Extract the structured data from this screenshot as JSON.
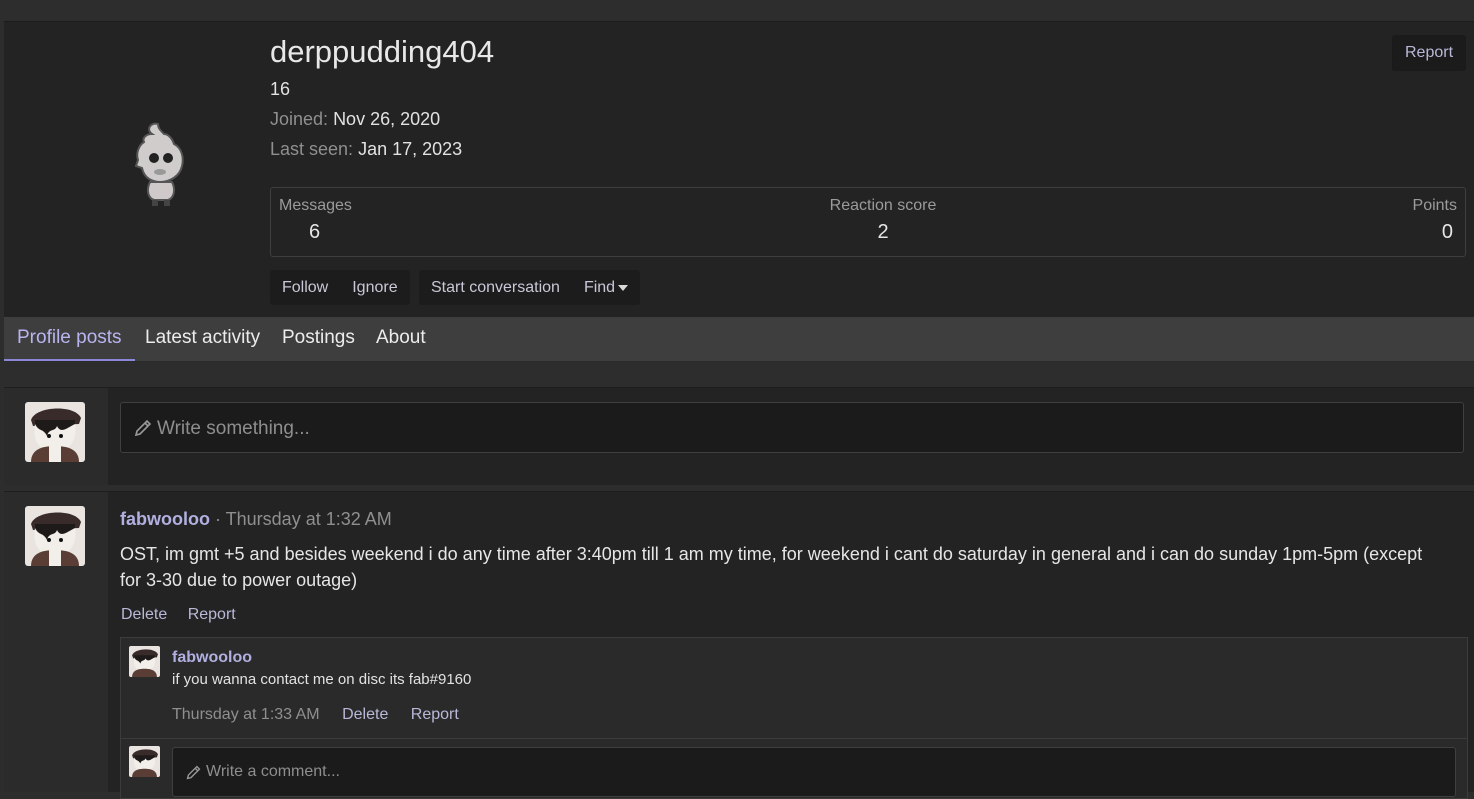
{
  "profile": {
    "username": "derppudding404",
    "user_title": "16",
    "joined_label": "Joined:",
    "joined_value": "Nov 26, 2020",
    "last_seen_label": "Last seen:",
    "last_seen_value": "Jan 17, 2023",
    "report_label": "Report",
    "stats": {
      "messages_label": "Messages",
      "messages_value": "6",
      "reaction_label": "Reaction score",
      "reaction_value": "2",
      "points_label": "Points",
      "points_value": "0"
    },
    "buttons": {
      "follow": "Follow",
      "ignore": "Ignore",
      "start_conversation": "Start conversation",
      "find": "Find"
    }
  },
  "tabs": [
    {
      "label": "Profile posts",
      "active": true
    },
    {
      "label": "Latest activity",
      "active": false
    },
    {
      "label": "Postings",
      "active": false
    },
    {
      "label": "About",
      "active": false
    }
  ],
  "composer": {
    "placeholder": "Write something..."
  },
  "post": {
    "author": "fabwooloo",
    "separator": " · ",
    "time": "Thursday at 1:32 AM",
    "body": "OST, im gmt +5 and besides weekend i do any time after 3:40pm till 1 am my time, for weekend i cant do saturday in general and i can do sunday 1pm-5pm (except for 3-30 due to power outage)",
    "delete_label": "Delete",
    "report_label": "Report",
    "comment": {
      "author": "fabwooloo",
      "text": "if you wanna contact me on disc its fab#9160",
      "time": "Thursday at 1:33 AM",
      "delete_label": "Delete",
      "report_label": "Report"
    },
    "comment_placeholder": "Write a comment..."
  }
}
